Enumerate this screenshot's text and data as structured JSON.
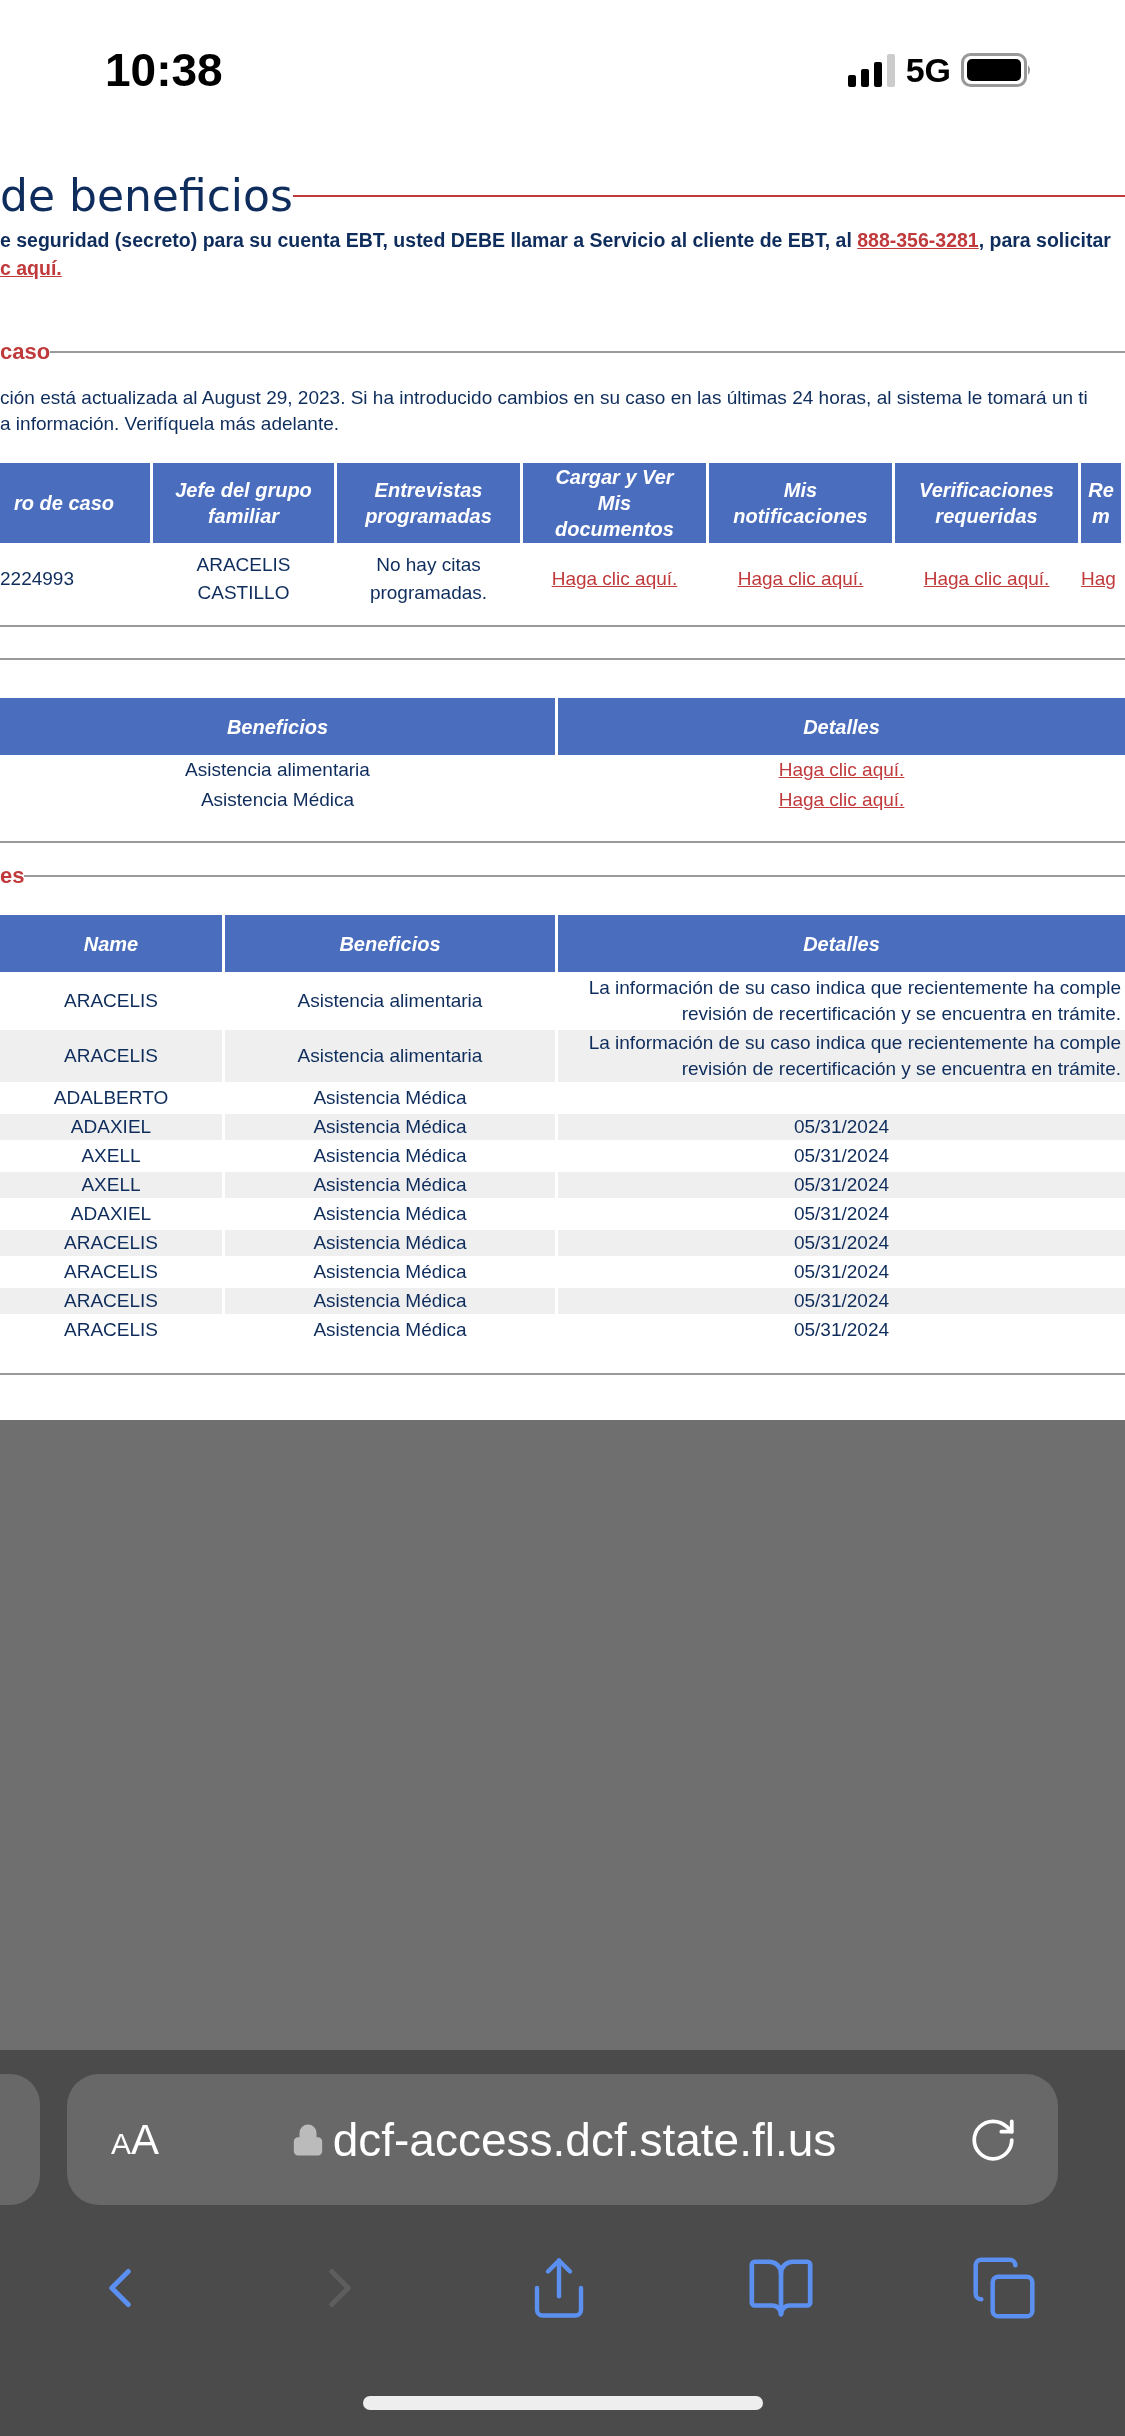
{
  "status_bar": {
    "time": "10:38",
    "network": "5G"
  },
  "page": {
    "title": "de beneficios",
    "notice": {
      "before": "e seguridad (secreto) para su cuenta EBT, usted DEBE llamar a Servicio al cliente de EBT, al ",
      "phone": "888-356-3281",
      "after": ", para solicitar",
      "link": "c aquí."
    },
    "case_section": {
      "heading": "caso",
      "text": "ción está actualizada al August 29, 2023. Si ha introducido cambios en su caso en las últimas 24 horas, al sistema le tomará un ti\na información. Verifíquela más adelante."
    },
    "case_table": {
      "columns": [
        "ro de caso",
        "Jefe del grupo familiar",
        "Entrevistas programadas",
        "Cargar y Ver Mis documentos",
        "Mis notificaciones",
        "Verificaciones requeridas",
        "Re m"
      ],
      "row": [
        {
          "kind": "text",
          "text": "2224993"
        },
        {
          "kind": "text",
          "text": "ARACELIS\nCASTILLO"
        },
        {
          "kind": "text",
          "text": "No hay citas\nprogramadas."
        },
        {
          "kind": "link",
          "text": "Haga clic aquí."
        },
        {
          "kind": "link",
          "text": "Haga clic aquí."
        },
        {
          "kind": "link",
          "text": "Haga clic aquí."
        },
        {
          "kind": "link",
          "text": "Hag"
        }
      ]
    },
    "benefits_table": {
      "columns": [
        "Beneficios",
        "Detalles"
      ],
      "rows": [
        {
          "benefit": "Asistencia alimentaria",
          "details": "Haga clic aquí."
        },
        {
          "benefit": "Asistencia Médica",
          "details": "Haga clic aquí."
        }
      ]
    },
    "status_section": {
      "heading": "es",
      "columns": [
        "Name",
        "Beneficios",
        "Detalles"
      ],
      "rows": [
        {
          "name": "ARACELIS",
          "benefit": "Asistencia alimentaria",
          "details": "La información de su caso indica que recientemente ha comple\nrevisión de recertificación y se encuentra en trámite."
        },
        {
          "name": "ARACELIS",
          "benefit": "Asistencia alimentaria",
          "details": "La información de su caso indica que recientemente ha comple\nrevisión de recertificación y se encuentra en trámite."
        },
        {
          "name": "ADALBERTO",
          "benefit": "Asistencia Médica"
        },
        {
          "name": "ADAXIEL",
          "benefit": "Asistencia Médica",
          "details": "05/31/2024"
        },
        {
          "name": "AXELL",
          "benefit": "Asistencia Médica",
          "details": "05/31/2024"
        },
        {
          "name": "AXELL",
          "benefit": "Asistencia Médica",
          "details": "05/31/2024"
        },
        {
          "name": "ADAXIEL",
          "benefit": "Asistencia Médica",
          "details": "05/31/2024"
        },
        {
          "name": "ARACELIS",
          "benefit": "Asistencia Médica",
          "details": "05/31/2024"
        },
        {
          "name": "ARACELIS",
          "benefit": "Asistencia Médica",
          "details": "05/31/2024"
        },
        {
          "name": "ARACELIS",
          "benefit": "Asistencia Médica",
          "details": "05/31/2024"
        },
        {
          "name": "ARACELIS",
          "benefit": "Asistencia Médica",
          "details": "05/31/2024"
        }
      ]
    }
  },
  "browser": {
    "text_size": "AA",
    "url": "dcf-access.dcf.state.fl.us",
    "forward_disabled": true
  }
}
